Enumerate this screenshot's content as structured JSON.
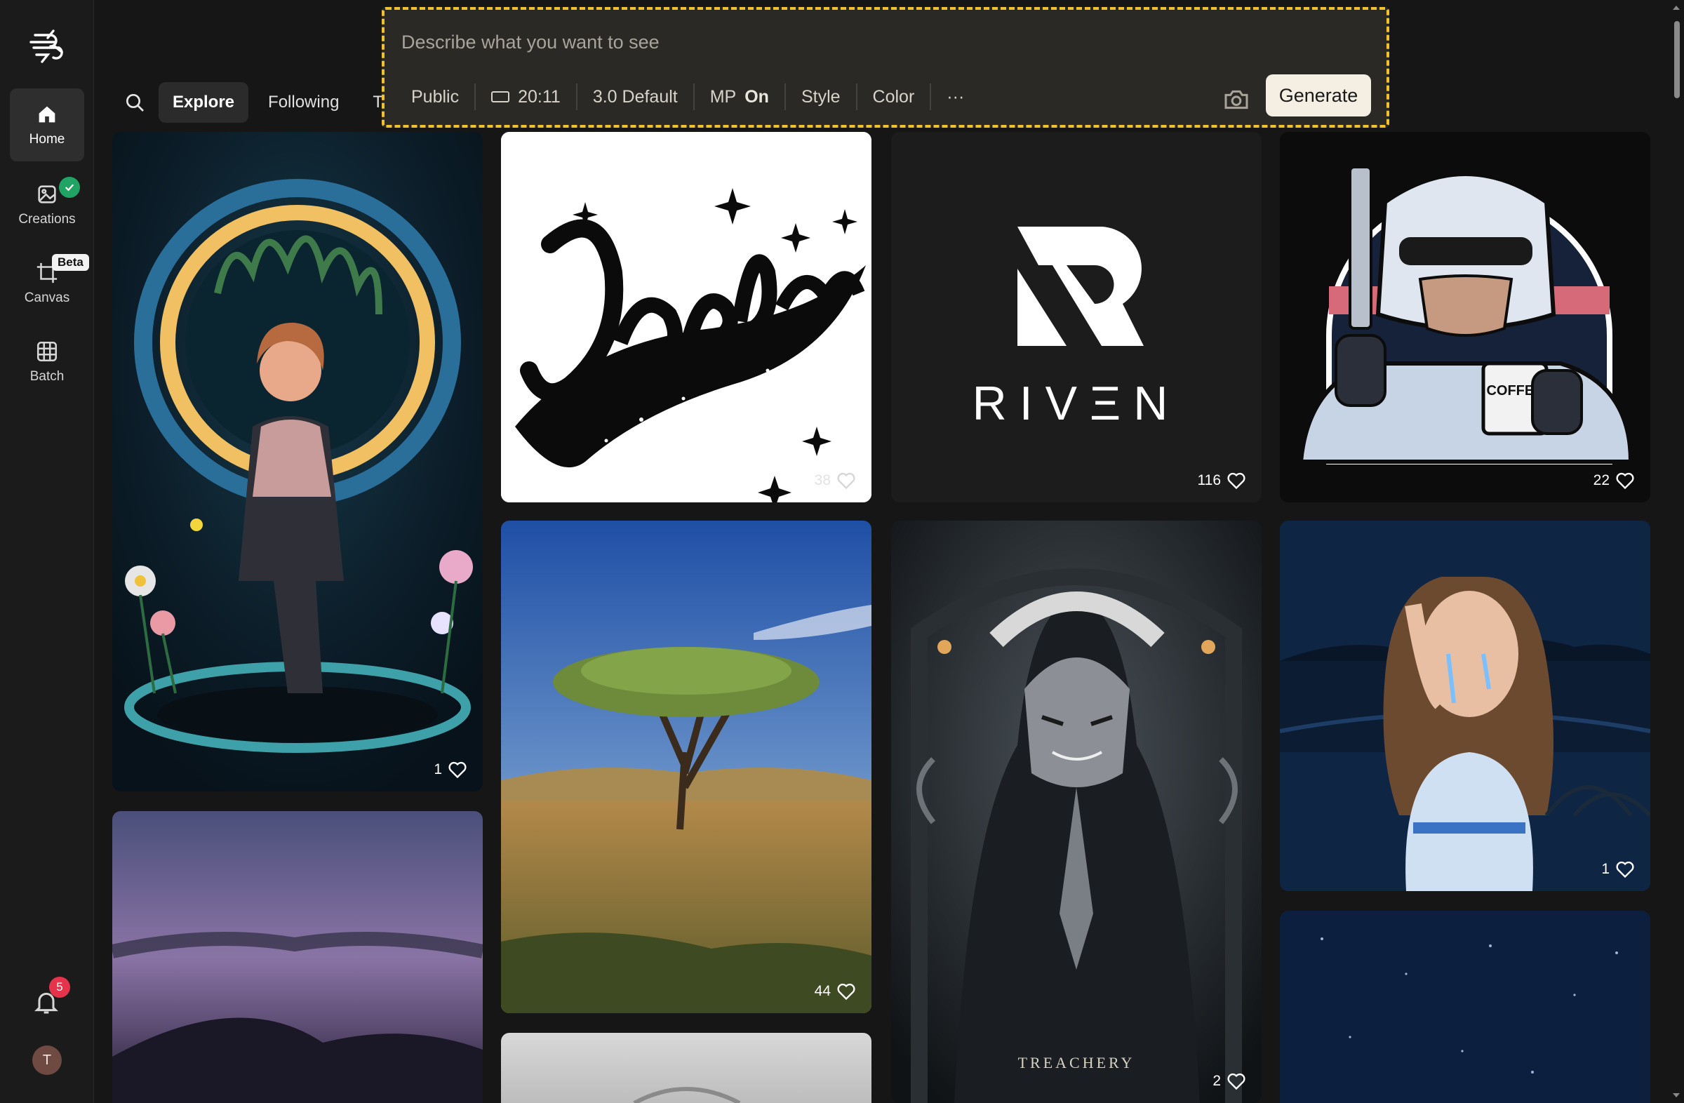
{
  "sidebar": {
    "items": [
      {
        "label": "Home",
        "icon": "home-icon",
        "active": true
      },
      {
        "label": "Creations",
        "icon": "image-icon"
      },
      {
        "label": "Canvas",
        "icon": "crop-icon",
        "badge": "Beta"
      },
      {
        "label": "Batch",
        "icon": "grid-icon"
      }
    ],
    "notifications": "5",
    "avatar_initial": "T"
  },
  "tabs": [
    "Explore",
    "Following",
    "Top"
  ],
  "prompt": {
    "placeholder": "Describe what you want to see",
    "visibility": "Public",
    "ratio": "20:11",
    "model": "3.0 Default",
    "mp_label": "MP",
    "mp_value": "On",
    "style": "Style",
    "color": "Color",
    "more": "···",
    "generate": "Generate"
  },
  "cards": [
    {
      "likes": "1"
    },
    {
      "likes": "38"
    },
    {
      "likes": "116",
      "logo_text": "RIVΞN"
    },
    {
      "likes": "22",
      "mug_text": "COFFEE"
    },
    {
      "likes": "44"
    },
    {
      "likes": "2",
      "caption": "TREACHERY"
    },
    {
      "likes": "1"
    }
  ],
  "colors": {
    "accent": "#f2c12e",
    "bg": "#161616",
    "badge_red": "#e5334b",
    "check_green": "#1fa463"
  }
}
